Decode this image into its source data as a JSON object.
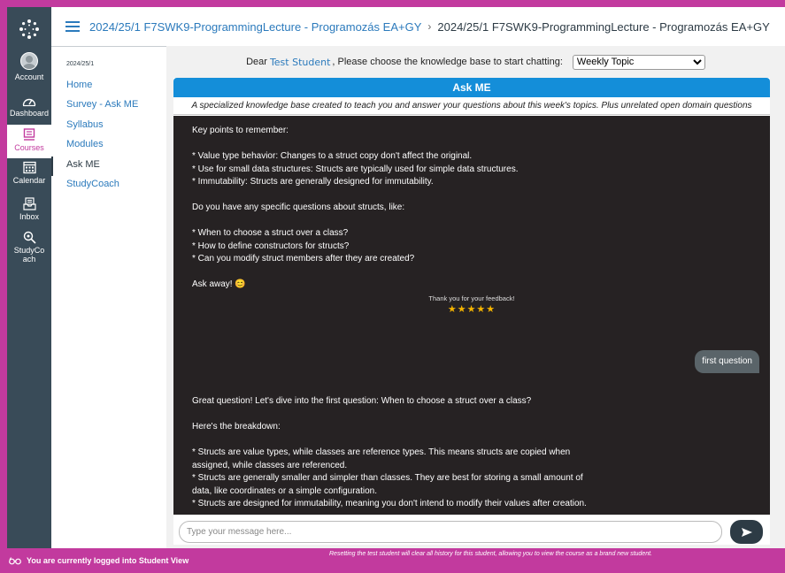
{
  "global_nav": {
    "items": [
      {
        "label": "Account",
        "icon": "account-avatar"
      },
      {
        "label": "Dashboard",
        "icon": "dashboard-icon"
      },
      {
        "label": "Courses",
        "icon": "courses-icon"
      },
      {
        "label": "Calendar",
        "icon": "calendar-icon"
      },
      {
        "label": "Inbox",
        "icon": "inbox-icon"
      },
      {
        "label": "StudyCoach",
        "icon": "search-icon"
      }
    ],
    "active": "Courses"
  },
  "breadcrumb": {
    "course_link": "2024/25/1 F7SWK9-ProgrammingLecture - Programozás EA+GY",
    "current": "2024/25/1 F7SWK9-ProgrammingLecture - Programozás EA+GY"
  },
  "course_nav": {
    "term": "2024/25/1",
    "items": [
      "Home",
      "Survey - Ask ME",
      "Syllabus",
      "Modules",
      "Ask ME",
      "StudyCoach"
    ],
    "active": "Ask ME"
  },
  "kb_bar": {
    "prefix": "Dear",
    "student_name": "Test Student",
    "suffix": ", Please choose the knowledge base to start chatting:",
    "selected": "Weekly Topic"
  },
  "panel": {
    "title": "Ask ME",
    "description": "A specialized knowledge base created to teach you and answer your questions about this week's topics. Plus unrelated open domain questions"
  },
  "chat": {
    "bot_message_1": "Key points to remember:\n\n* Value type behavior: Changes to a struct copy don't affect the original.\n* Use for small data structures: Structs are typically used for simple data structures.\n* Immutability: Structs are generally designed for immutability.\n\nDo you have any specific questions about structs, like:\n\n* When to choose a struct over a class?\n* How to define constructors for structs?\n* Can you modify struct members after they are created?\n\nAsk away! 😊",
    "feedback_text": "Thank you for your feedback!",
    "rating": "★★★★★",
    "user_message": "first question",
    "bot_message_2": "Great question! Let's dive into the first question: When to choose a struct over a class?\n\nHere's the breakdown:\n\n* Structs are value types, while classes are reference types. This means structs are copied when\nassigned, while classes are referenced.\n* Structs are generally smaller and simpler than classes. They are best for storing a small amount of\ndata, like coordinates or a simple configuration.\n* Structs are designed for immutability, meaning you don't intend to modify their values after creation."
  },
  "composer": {
    "placeholder": "Type your message here...",
    "send_icon": "send-icon"
  },
  "student_view": {
    "status": "You are currently logged into Student View",
    "reset_note": "Resetting the test student will clear all history for this student, allowing you to view the course as a brand new student."
  },
  "colors": {
    "brand": "#c23a9e",
    "nav_bg": "#394b58",
    "link": "#2b7abc",
    "header_blue": "#148ed9",
    "chat_bg": "#262223"
  }
}
